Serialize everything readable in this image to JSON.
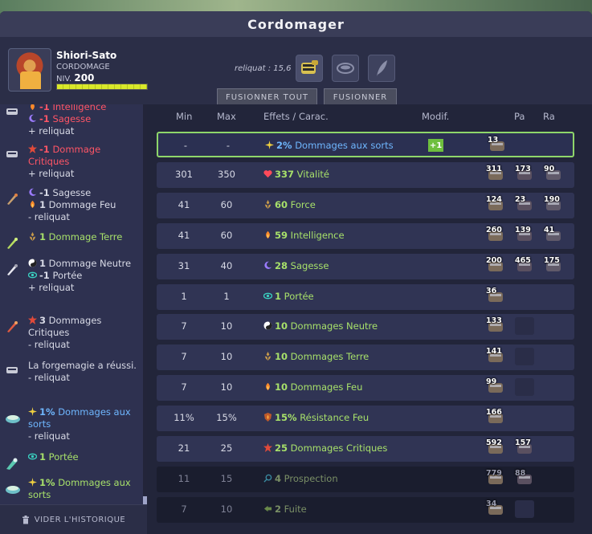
{
  "window": {
    "title": "Cordomager"
  },
  "player": {
    "name": "Shiori-Sato",
    "job": "CORDOMAGE",
    "level_label": "NIV.",
    "level": "200",
    "xp_fraction": 1.0
  },
  "reliquat_label": "reliquat : 15,6",
  "buttons": {
    "merge_all": "FUSIONNER TOUT",
    "merge": "FUSIONNER"
  },
  "history": {
    "clear_label": "VIDER L'HISTORIQUE",
    "entries": [
      {
        "lines": [
          {
            "icon": "intelligence-icon",
            "prefix": "-1",
            "text": "Intelligence",
            "color": "red"
          },
          {
            "icon": "wisdom-icon",
            "prefix": "-1",
            "text": "Sagesse",
            "color": "red"
          }
        ],
        "note": "+ reliquat"
      },
      {
        "lines": [
          {
            "icon": "crit-icon",
            "prefix": "-1",
            "text": "Dommage Critiques",
            "color": "red"
          }
        ],
        "note": "+ reliquat"
      },
      {
        "lines": [
          {
            "icon": "wisdom-icon",
            "prefix": "-1",
            "text": "Sagesse",
            "color": "white"
          },
          {
            "icon": "fire-icon",
            "prefix": "1",
            "text": "Dommage Feu",
            "color": "white"
          }
        ],
        "note": "- reliquat"
      },
      {
        "lines": [
          {
            "icon": "earth-icon",
            "prefix": "1",
            "text": "Dommage Terre",
            "color": "green"
          }
        ],
        "note": ""
      },
      {
        "lines": [
          {
            "icon": "neutral-icon",
            "prefix": "1",
            "text": "Dommage Neutre",
            "color": "white"
          },
          {
            "icon": "range-icon",
            "prefix": "-1",
            "text": "Portée",
            "color": "white"
          }
        ],
        "note": "+ reliquat"
      },
      {
        "lines": [
          {
            "icon": "crit-icon",
            "prefix": "3",
            "text": "Dommages Critiques",
            "color": "white"
          }
        ],
        "note": "- reliquat"
      },
      {
        "lines": [
          {
            "icon": "",
            "prefix": "",
            "text": "La forgemagie a réussi.",
            "color": "white"
          }
        ],
        "note": "- reliquat"
      },
      {
        "lines": [
          {
            "icon": "spell-damage-icon",
            "prefix": "1%",
            "text": "Dommages aux sorts",
            "color": "blue"
          }
        ],
        "note": "- reliquat"
      },
      {
        "lines": [
          {
            "icon": "range-icon",
            "prefix": "1",
            "text": "Portée",
            "color": "green"
          }
        ],
        "note": ""
      },
      {
        "lines": [
          {
            "icon": "spell-damage-icon",
            "prefix": "1%",
            "text": "Dommages aux sorts",
            "color": "green"
          }
        ],
        "note": ""
      }
    ]
  },
  "table": {
    "headers": {
      "min": "Min",
      "max": "Max",
      "effects": "Effets / Carac.",
      "modif": "Modif.",
      "pa": "Pa",
      "ra": "Ra"
    },
    "rows": [
      {
        "min": "-",
        "max": "-",
        "value": "2%",
        "name": "Dommages aux sorts",
        "color": "blue",
        "icon": "spell-damage-icon",
        "modif": "+1",
        "runes": [
          "13"
        ]
      },
      {
        "min": "301",
        "max": "350",
        "value": "337",
        "name": "Vitalité",
        "color": "green",
        "icon": "heart-icon",
        "modif": "",
        "runes": [
          "311",
          "173",
          "90"
        ]
      },
      {
        "min": "41",
        "max": "60",
        "value": "60",
        "name": "Force",
        "color": "green",
        "icon": "earth-icon",
        "modif": "",
        "runes": [
          "124",
          "23",
          "190"
        ]
      },
      {
        "min": "41",
        "max": "60",
        "value": "59",
        "name": "Intelligence",
        "color": "green",
        "icon": "fire-icon",
        "modif": "",
        "runes": [
          "260",
          "139",
          "41"
        ]
      },
      {
        "min": "31",
        "max": "40",
        "value": "28",
        "name": "Sagesse",
        "color": "green",
        "icon": "wisdom-icon",
        "modif": "",
        "runes": [
          "200",
          "465",
          "175"
        ]
      },
      {
        "min": "1",
        "max": "1",
        "value": "1",
        "name": "Portée",
        "color": "green",
        "icon": "range-icon",
        "modif": "",
        "runes": [
          "36"
        ]
      },
      {
        "min": "7",
        "max": "10",
        "value": "10",
        "name": "Dommages Neutre",
        "color": "green",
        "icon": "neutral-icon",
        "modif": "",
        "runes": [
          "133",
          ""
        ]
      },
      {
        "min": "7",
        "max": "10",
        "value": "10",
        "name": "Dommages Terre",
        "color": "green",
        "icon": "earth-icon",
        "modif": "",
        "runes": [
          "141",
          ""
        ]
      },
      {
        "min": "7",
        "max": "10",
        "value": "10",
        "name": "Dommages Feu",
        "color": "green",
        "icon": "fire-icon",
        "modif": "",
        "runes": [
          "99",
          ""
        ]
      },
      {
        "min": "11%",
        "max": "15%",
        "value": "15%",
        "name": "Résistance Feu",
        "color": "green",
        "icon": "fire-resist-icon",
        "modif": "",
        "runes": [
          "166"
        ]
      },
      {
        "min": "21",
        "max": "25",
        "value": "25",
        "name": "Dommages Critiques",
        "color": "green",
        "icon": "crit-icon",
        "modif": "",
        "runes": [
          "592",
          "157"
        ]
      },
      {
        "min": "11",
        "max": "15",
        "value": "4",
        "name": "Prospection",
        "color": "dim",
        "icon": "prospection-icon",
        "modif": "",
        "runes": [
          "779",
          "88"
        ]
      },
      {
        "min": "7",
        "max": "10",
        "value": "2",
        "name": "Fuite",
        "color": "dim",
        "icon": "flee-icon",
        "modif": "",
        "runes": [
          "34",
          ""
        ]
      }
    ]
  }
}
